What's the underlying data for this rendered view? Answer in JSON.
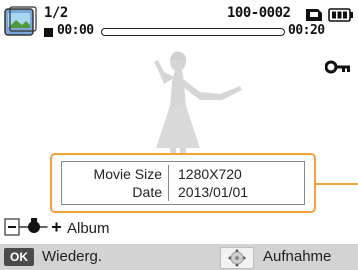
{
  "status": {
    "thumbnail_icon": "video-thumbnail-icon",
    "counter": "1/2",
    "file_number": "100-0002",
    "card_icon": "memory-card-icon",
    "battery_icon": "battery-icon"
  },
  "playback": {
    "stop_icon": "stop-icon",
    "elapsed": "00:00",
    "total": "00:20",
    "progress_fraction": 0
  },
  "protect_icon": "key-icon",
  "info": {
    "rows": [
      {
        "label": "Movie Size",
        "value": "1280X720"
      },
      {
        "label": "Date",
        "value": "2013/01/01"
      }
    ]
  },
  "album": {
    "zoom_minus": "−",
    "zoom_plus": "+",
    "label": "Album"
  },
  "bottom_bar": {
    "ok_key": "OK",
    "play_label": "Wiederg.",
    "record_label": "Aufnahme"
  },
  "colors": {
    "accent": "#f0a13a",
    "bar": "#d3d3d3"
  }
}
